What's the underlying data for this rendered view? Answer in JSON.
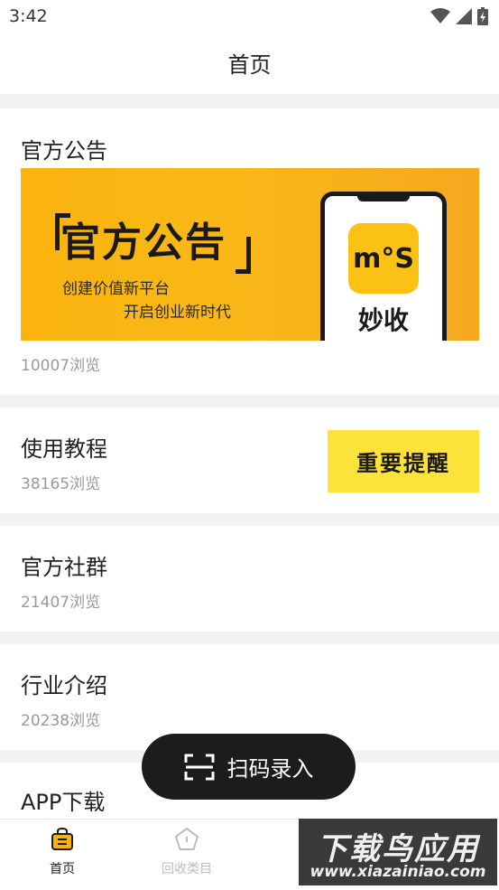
{
  "status_bar": {
    "time": "3:42"
  },
  "header": {
    "title": "首页"
  },
  "cards": [
    {
      "title": "官方公告",
      "views": "10007浏览"
    },
    {
      "title": "使用教程",
      "views": "38165浏览"
    },
    {
      "title": "官方社群",
      "views": "21407浏览"
    },
    {
      "title": "行业介绍",
      "views": "20238浏览"
    },
    {
      "title": "APP下载"
    }
  ],
  "banner": {
    "title": "官方公告",
    "line1": "创建价值新平台",
    "line2": "开启创业新时代",
    "app_logo": "m°S",
    "app_name": "妙收"
  },
  "reminder_label": "重要提醒",
  "scan_button": {
    "label": "扫码录入"
  },
  "tabbar": {
    "items": [
      {
        "label": "首页",
        "icon": "bag-icon",
        "color": "#f6b30f"
      },
      {
        "label": "回收类目",
        "icon": "pentagon-icon",
        "color": "#bbbbbb"
      }
    ]
  },
  "watermark": {
    "top": "下载鸟应用",
    "bottom": "www.xiazainiao.com"
  },
  "colors": {
    "accent": "#fcc115",
    "reminder": "#fde23a",
    "scan_bg": "#1c1c1c"
  }
}
